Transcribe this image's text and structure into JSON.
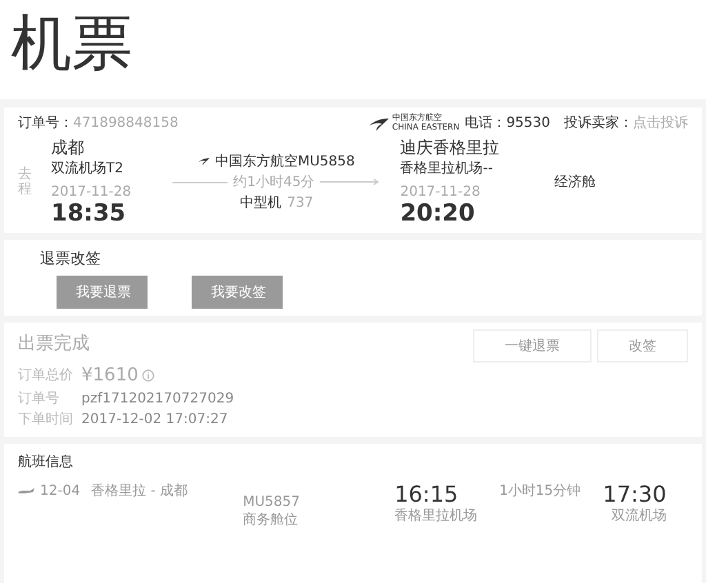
{
  "title": "机票",
  "order": {
    "number_label": "订单号：",
    "number": "471898848158",
    "airline_logo": {
      "name_cn": "中国东方航空",
      "name_en": "CHINA EASTERN"
    },
    "phone_label": "电话：",
    "phone": "95530",
    "complaint_label": "投诉卖家：",
    "complaint_link": "点击投诉"
  },
  "trip": {
    "direction": "去程",
    "depart": {
      "city": "成都",
      "airport": "双流机场T2",
      "date": "2017-11-28",
      "time": "18:35"
    },
    "flight": "中国东方航空MU5858",
    "duration": "约1小时45分",
    "aircraft": "中型机",
    "aircraft_model": "737",
    "arrive": {
      "city": "迪庆香格里拉",
      "airport": "香格里拉机场--",
      "date": "2017-11-28",
      "time": "20:20"
    },
    "cabin": "经济舱"
  },
  "refund": {
    "title": "退票改签",
    "buttons": [
      {
        "label": "我要退票",
        "disabled": true
      },
      {
        "label": "我要改签",
        "disabled": true
      }
    ]
  },
  "status": {
    "title": "出票完成",
    "buttons": [
      {
        "label": "一键退票",
        "disabled": true
      },
      {
        "label": "改签",
        "disabled": true
      }
    ],
    "fields": [
      {
        "label": "订单总价",
        "value": "¥1610",
        "kind": "price"
      },
      {
        "label": "订单号",
        "value": "pzf171202170727029",
        "kind": "text"
      },
      {
        "label": "下单时间",
        "value": "2017-12-02 17:07:27",
        "kind": "text"
      }
    ]
  },
  "flight_info": {
    "title": "航班信息",
    "segments": [
      {
        "date": "12-04",
        "route": "香格里拉 - 成都",
        "flight": "MU5857",
        "cabin": "商务舱位",
        "depart_time": "16:15",
        "depart_airport": "香格里拉机场",
        "duration": "1小时15分钟",
        "arrive_time": "17:30",
        "arrive_airport": "双流机场"
      }
    ]
  }
}
